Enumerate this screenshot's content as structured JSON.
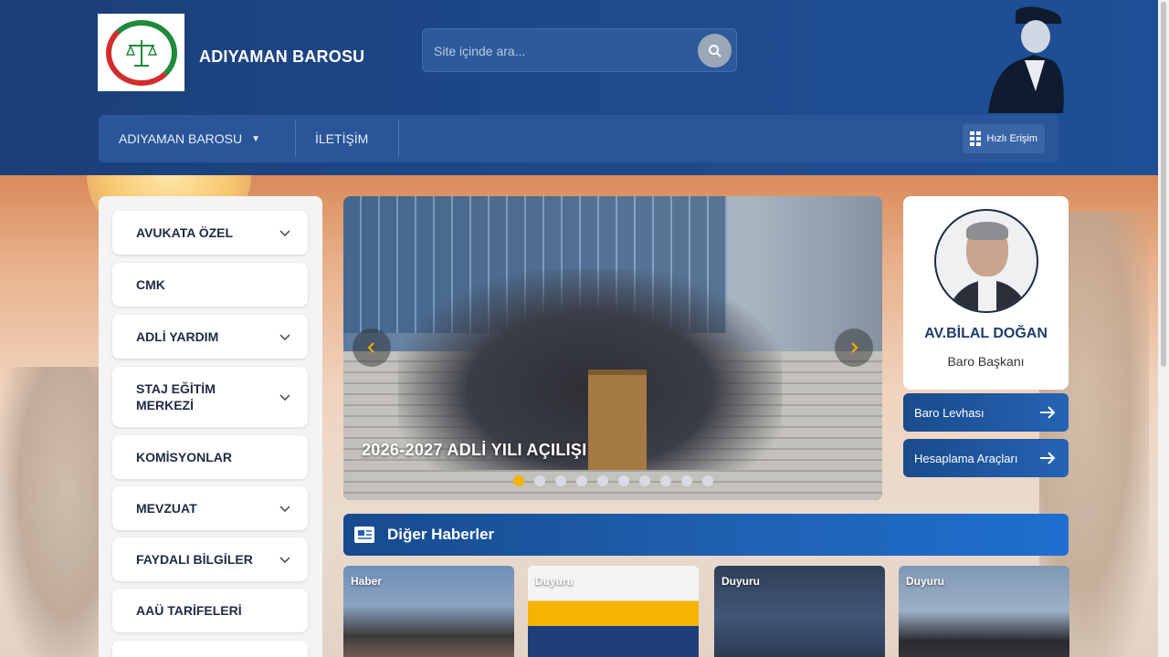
{
  "header": {
    "brand": "ADIYAMAN BAROSU",
    "search": {
      "placeholder": "Site içinde ara..."
    }
  },
  "nav": {
    "items": [
      {
        "label": "ADIYAMAN BAROSU",
        "has_dropdown": true
      },
      {
        "label": "İLETİŞİM",
        "has_dropdown": false
      }
    ],
    "quick_access": "Hızlı Erişim"
  },
  "sidebar": {
    "items": [
      {
        "label": "AVUKATA ÖZEL",
        "expandable": true
      },
      {
        "label": "CMK",
        "expandable": false
      },
      {
        "label": "ADLİ YARDIM",
        "expandable": true
      },
      {
        "label": "STAJ EĞİTİM MERKEZİ",
        "expandable": true
      },
      {
        "label": "KOMİSYONLAR",
        "expandable": false
      },
      {
        "label": "MEVZUAT",
        "expandable": true
      },
      {
        "label": "FAYDALI BİLGİLER",
        "expandable": true
      },
      {
        "label": "AAÜ TARİFELERİ",
        "expandable": false
      }
    ]
  },
  "slider": {
    "caption": "2026-2027 ADLİ YILI AÇILIŞI",
    "dot_count": 10,
    "active_dot": 1
  },
  "president": {
    "name": "AV.BİLAL DOĞAN",
    "title": "Baro Başkanı"
  },
  "quick_links": [
    {
      "label": "Baro Levhası"
    },
    {
      "label": "Hesaplama Araçları"
    }
  ],
  "news": {
    "title": "Diğer Haberler",
    "cards": [
      {
        "tag": "Haber"
      },
      {
        "tag": "Duyuru"
      },
      {
        "tag": "Duyuru"
      },
      {
        "tag": "Duyuru"
      }
    ]
  },
  "colors": {
    "header_bg": "#1d4a8c",
    "accent_gold": "#f4b400",
    "news_bar": "#1f61b2"
  }
}
